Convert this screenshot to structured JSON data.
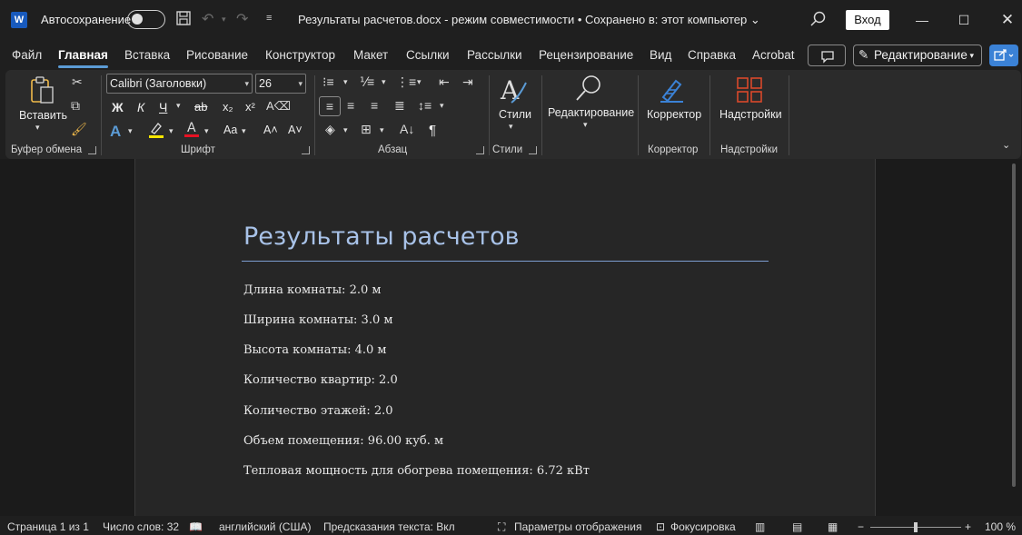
{
  "titlebar": {
    "app_logo": "W",
    "autosave_label": "Автосохранение",
    "doc_title": "Результаты расчетов.docx  -  режим совместимости  •  Сохранено в: этот компьютер",
    "login_label": "Вход",
    "icons": [
      "save-icon",
      "undo-icon",
      "redo-icon",
      "customize-icon",
      "search-icon",
      "minimize-icon",
      "maximize-icon",
      "close-icon"
    ]
  },
  "tabs": [
    "Файл",
    "Главная",
    "Вставка",
    "Рисование",
    "Конструктор",
    "Макет",
    "Ссылки",
    "Рассылки",
    "Рецензирование",
    "Вид",
    "Справка",
    "Acrobat"
  ],
  "active_tab": "Главная",
  "editing_mode_label": "Редактирование",
  "ribbon": {
    "clipboard": {
      "paste_label": "Вставить",
      "group_label": "Буфер обмена"
    },
    "font": {
      "font_name": "Calibri (Заголовки)",
      "font_size": "26",
      "bold": "Ж",
      "italic": "К",
      "underline": "Ч",
      "strike": "ab",
      "subscript": "x₂",
      "superscript": "x²",
      "change_case": "Aa",
      "grow": "A˄",
      "shrink": "A˅",
      "group_label": "Шрифт"
    },
    "paragraph": {
      "group_label": "Абзац",
      "pilcrow": "¶"
    },
    "styles": {
      "label": "Стили",
      "group_label": "Стили"
    },
    "editing": {
      "label": "Редактирование"
    },
    "corrector": {
      "label": "Корректор",
      "group_label": "Корректор"
    },
    "addins": {
      "label": "Надстройки",
      "group_label": "Надстройки"
    }
  },
  "document": {
    "heading": "Результаты расчетов",
    "lines": [
      "Длина комнаты: 2.0 м",
      "Ширина комнаты: 3.0 м",
      "Высота комнаты: 4.0 м",
      "Количество квартир: 2.0",
      "Количество этажей: 2.0",
      "Объем помещения: 96.00 куб. м",
      "Тепловая мощность для обогрева помещения: 6.72 кВт"
    ]
  },
  "statusbar": {
    "page": "Страница 1 из 1",
    "words": "Число слов: 32",
    "language": "английский (США)",
    "predictions": "Предсказания текста: Вкл",
    "display_settings": "Параметры отображения",
    "focus": "Фокусировка",
    "zoom": "100 %",
    "zoom_level": 100
  },
  "colors": {
    "accent": "#5b9bd5",
    "heading": "#a8c2e8",
    "share_button": "#3b82d6"
  }
}
